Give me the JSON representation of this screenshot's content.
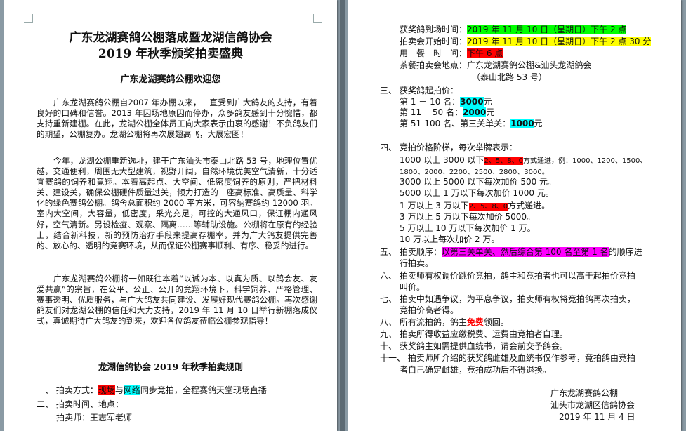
{
  "left_page": {
    "title_line1": "广东龙湖赛鸽公棚落成暨龙湖信鸽协会",
    "title_line2": "2019 年秋季颁奖拍卖盛典",
    "welcome": "广东龙湖赛鸽公棚欢迎您",
    "para1": "广东龙湖赛鸽公棚自2007 年办棚以来，一直受到广大鸽友的支持，有着良好的口碑和信誉。2013 年因场地原因而停办，众多鸽友感到十分惋惜，都支持重新建棚。在此，龙湖公棚全体员工向大家表示由衷的感谢！不负鸽友们的期望，公棚复办。龙湖公棚将再次展翅高飞，大展宏图！",
    "para2": "今年，龙湖公棚重新选址，建于广东汕头市泰山北路 53 号，地理位置优越，交通便利，周围无大型建筑，视野开阔，自然环境优美空气清新，十分适宜赛鸽的饲养和竟翔。本着高起点、大空间、低密度饲养的原则，严把材料关、建设关，确保公棚硬件质量过关，倾力打造的一座高标准、高质量、科学化的绿色赛鸽公棚。鸽舍总面积约 2000 平方米，可容纳赛鸽约 12000 羽。室内大空间，大容量，低密度，采光充足，可控的大通风口，保证棚内通风好，空气清新。另设检疫、观察、隔离……等辅助设施。公棚将在原有的经验上，结合新科技，新的预防治疗手段来提高存棚率，并为广大鸽友提供完善的、放心的、透明的竞赛环境，从而保证公棚赛事顺利、有序、稳妥的进行。",
    "para3": "广东龙湖赛鸽公棚将一如既往本着“以诚为本、以真为质、以鸽会友、友爱共赢”的宗旨，在公平、公正、公开的竟翔环境下，科学饲养、严格管理、赛事透明、优质服务，与广大鸽友共同建设、发展好现代赛鸽公棚。再次感谢鸽友们对龙湖公棚的信任和大力支持，2019 年 11 月 10 日举行新棚落成仪式，真诚期待广大鸽友的到来，欢迎各位鸽友莅临公棚参观指导！",
    "rules_title": "龙湖信鸽协会 2019 年秋季拍卖规则",
    "r1_prefix": "一、 拍卖方式：",
    "r1_hl1": "现场",
    "r1_mid": "与",
    "r1_hl2": "网络",
    "r1_suffix": "同步竞拍，全程赛鸽天堂现场直播",
    "r2": "二、 拍卖时间、地点：",
    "r2_sub": "拍卖师：王志军老师"
  },
  "right_page": {
    "arrive_label": "获奖鸽到场时间：",
    "arrive_value": "2019 年 11 月 10 日（星期日）下午 2 点",
    "start_label": "拍卖会开始时间：",
    "start_value": "2019 年 11 月 10 日（星期日）下午 2 点 30 分",
    "meal_label": "用　餐　时　间：",
    "meal_value": "下午 6 点",
    "venue_label": "茶餐拍卖会地点：",
    "venue_value1": "广东龙湖赛鸽公棚&汕头龙湖鸽会",
    "venue_value2": "（泰山北路 53 号）",
    "s3_title": "三、 获奖鸽起拍价：",
    "s3_l1_prefix": "第 1 － 10 名：",
    "s3_l1_value": "3000",
    "s3_l1_unit": "元",
    "s3_l2_prefix": "第 11 －50 名：",
    "s3_l2_value": "2000",
    "s3_l2_unit": "元",
    "s3_l3_prefix": "第 51-100 名、第三关单关：",
    "s3_l3_value": "1000",
    "s3_l3_unit": "元",
    "s4_title": "四、 竞拍价格阶梯，每次举牌表示：",
    "s4_l1_prefix": "1000 以上 3000 以下",
    "s4_l1_hl": "2、5、8、0",
    "s4_l1_suffix": "方式递进，例：1000、1200、1500、",
    "s4_l2": "1800、2000、2200、2500、2800、3000。",
    "s4_l3": "3000 以上 5000 以下每次加价 500 元。",
    "s4_l4": "5000 以上 1 万以下每次加价 1000 元。",
    "s4_l5_prefix": "1 万以上 3 万以下",
    "s4_l5_hl": "2、5、8、0",
    "s4_l5_suffix": "方式递进。",
    "s4_l6": "3 万以上 5 万以下每次加价 5000。",
    "s4_l7": "5 万以上 10 万以下每次加价 1 万。",
    "s4_l8": "10 万以上每次加价 2 万。",
    "s5_prefix": "五、 拍卖顺序：",
    "s5_hl": "以第三关单关、然后综合第 100 名至第 1 名",
    "s5_suffix": "的顺序进",
    "s5_cont": "行拍卖。",
    "s6_l1": "六、 拍卖师有权调价跳价竞拍，鸽主和竞拍者也可以高于起拍价竞拍",
    "s6_l2": "叫价。",
    "s7_l1": "七、 拍卖中如遇争议，为平息争议，拍卖师有权将竞拍鸽再次拍卖，",
    "s7_l2": "竞拍价高者得。",
    "s8_prefix": "八、 所有流拍鸽，鸽主",
    "s8_red": "免费",
    "s8_suffix": "领回。",
    "s9": "九、 拍卖所得收益应缴税费、运费由竞拍者自理。",
    "s10": "十、 获奖鸽主如需提供血统书，请会前交予鸽会。",
    "s11_l1": "十一、  拍卖师所介绍的获奖鸽雌雄及血统书仅作参考，竟拍鸽由竞拍",
    "s11_l2": "者自己确定雌雄，竞拍成功后不得退换。",
    "sig1": "广东龙湖赛鸽公棚",
    "sig2": "汕头市龙湖区信鸽协会",
    "sig3": "2019 年 11 月 4 日"
  }
}
